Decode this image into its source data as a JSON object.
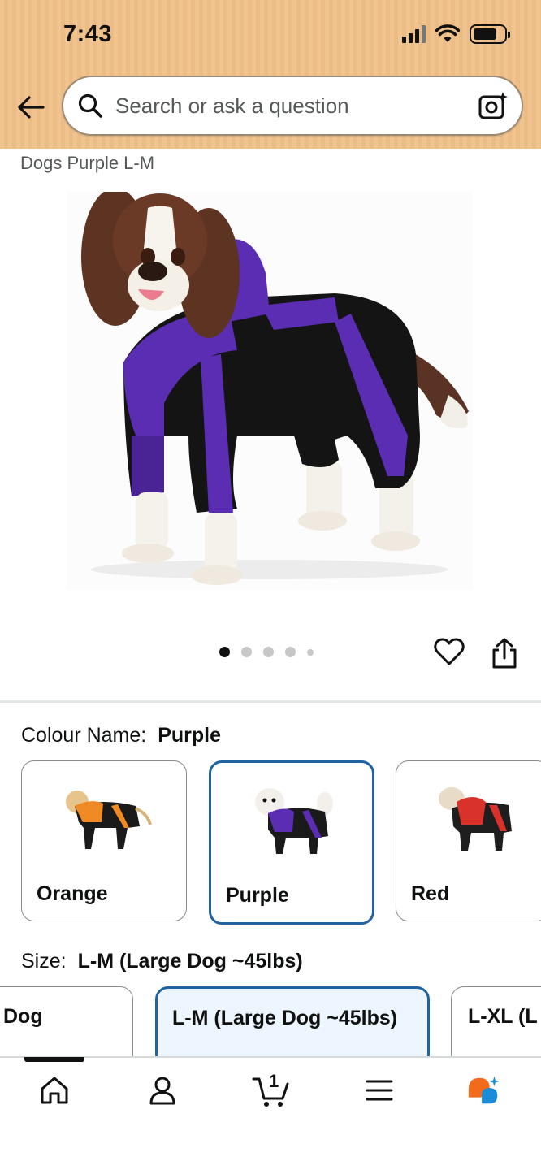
{
  "status_bar": {
    "time": "7:43"
  },
  "search": {
    "placeholder": "Search or ask a question"
  },
  "product": {
    "title_fragment": "Dogs Purple L-M"
  },
  "carousel": {
    "dot_count": 5,
    "active_index": 0
  },
  "colour": {
    "label": "Colour Name:",
    "selected": "Purple",
    "options": [
      {
        "label": "Orange",
        "accent": "#f08a24"
      },
      {
        "label": "Purple",
        "accent": "#5a2bb0"
      },
      {
        "label": "Red",
        "accent": "#d8322a"
      }
    ]
  },
  "size": {
    "label": "Size:",
    "selected": "L-M (Large Dog ~45lbs)",
    "options": [
      "Dog",
      "L-M (Large Dog ~45lbs)",
      "L-XL (L"
    ]
  },
  "bottom_nav": {
    "items": [
      "home-icon",
      "account-icon",
      "cart-icon",
      "menu-icon",
      "rufus-ai-icon"
    ],
    "cart_count": "1"
  },
  "colors": {
    "header_bg": "#f1c38f",
    "selected_border": "#2162a1",
    "selected_fill": "#edf6fe",
    "ai_orange": "#f26b1d",
    "ai_blue": "#1a8cd8"
  }
}
